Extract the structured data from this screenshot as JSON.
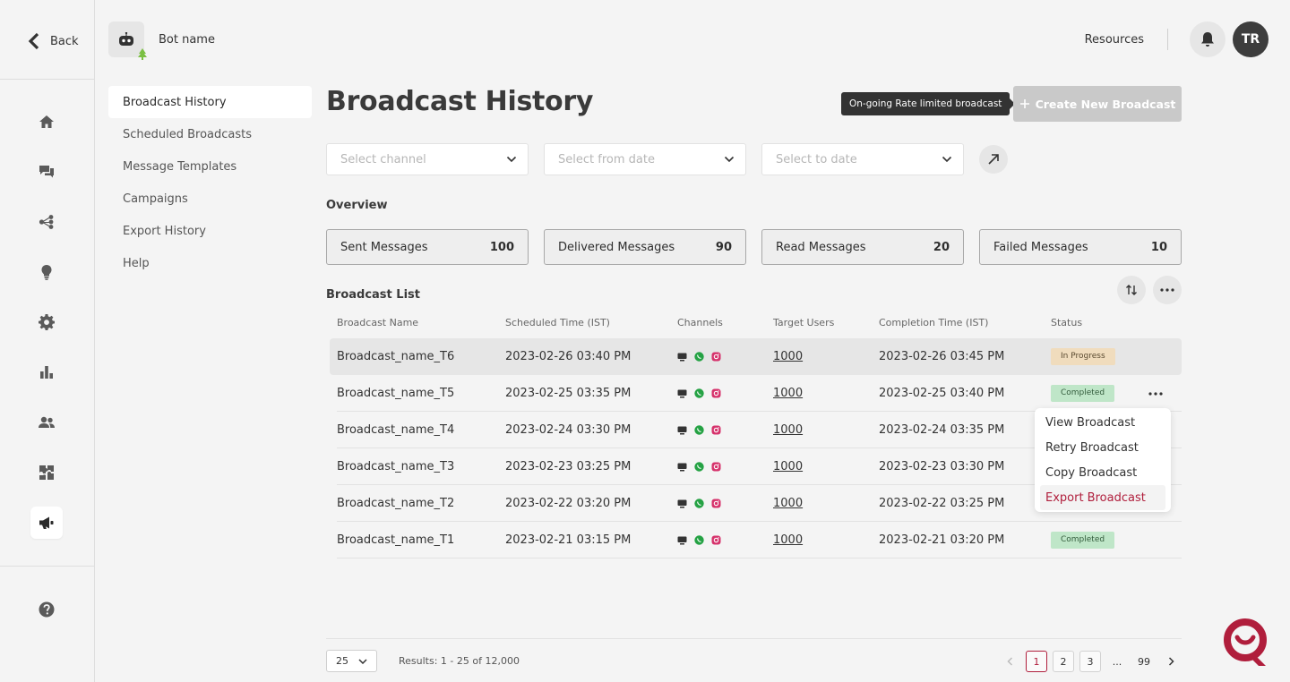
{
  "rail": {
    "back_label": "Back",
    "icons": [
      "home-icon",
      "chat-icon",
      "flow-icon",
      "bulb-icon",
      "settings-icon",
      "analytics-icon",
      "users-icon",
      "integrations-icon",
      "broadcast-icon",
      "help-icon"
    ],
    "active_icon": "broadcast-icon"
  },
  "bot": {
    "name": "Bot name"
  },
  "header": {
    "resources_label": "Resources",
    "avatar_initials": "TR"
  },
  "subnav": {
    "items": [
      {
        "label": "Broadcast History",
        "active": true
      },
      {
        "label": "Scheduled Broadcasts",
        "active": false
      },
      {
        "label": "Message Templates",
        "active": false
      },
      {
        "label": "Campaigns",
        "active": false
      },
      {
        "label": "Export History",
        "active": false
      },
      {
        "label": "Help",
        "active": false
      }
    ]
  },
  "page": {
    "title": "Broadcast History",
    "tooltip": "On-going Rate limited broadcast",
    "create_label": "Create New Broadcast"
  },
  "filters": {
    "channel_placeholder": "Select channel",
    "from_placeholder": "Select from date",
    "to_placeholder": "Select to date"
  },
  "overview": {
    "title": "Overview",
    "stats": [
      {
        "label": "Sent Messages",
        "value": "100"
      },
      {
        "label": "Delivered Messages",
        "value": "90"
      },
      {
        "label": "Read Messages",
        "value": "20"
      },
      {
        "label": "Failed Messages",
        "value": "10"
      }
    ]
  },
  "list": {
    "title": "Broadcast List",
    "columns": [
      "Broadcast Name",
      "Scheduled Time (IST)",
      "Channels",
      "Target Users",
      "Completion Time (IST)",
      "Status"
    ],
    "rows": [
      {
        "name": "Broadcast_name_T6",
        "scheduled": "2023-02-26 03:40 PM",
        "users": "1000",
        "completed": "2023-02-26 03:45 PM",
        "status": "In Progress"
      },
      {
        "name": "Broadcast_name_T5",
        "scheduled": "2023-02-25 03:35 PM",
        "users": "1000",
        "completed": "2023-02-25 03:40 PM",
        "status": "Completed"
      },
      {
        "name": "Broadcast_name_T4",
        "scheduled": "2023-02-24 03:30 PM",
        "users": "1000",
        "completed": "2023-02-24 03:35 PM",
        "status": ""
      },
      {
        "name": "Broadcast_name_T3",
        "scheduled": "2023-02-23 03:25 PM",
        "users": "1000",
        "completed": "2023-02-23 03:30 PM",
        "status": ""
      },
      {
        "name": "Broadcast_name_T2",
        "scheduled": "2023-02-22 03:20 PM",
        "users": "1000",
        "completed": "2023-02-22 03:25 PM",
        "status": ""
      },
      {
        "name": "Broadcast_name_T1",
        "scheduled": "2023-02-21 03:15 PM",
        "users": "1000",
        "completed": "2023-02-21 03:20 PM",
        "status": "Completed"
      }
    ]
  },
  "row_menu": {
    "items": [
      "View Broadcast",
      "Retry Broadcast",
      "Copy Broadcast",
      "Export Broadcast"
    ],
    "active_index": 3
  },
  "pager": {
    "per_page": "25",
    "results": "Results: 1 - 25 of 12,000",
    "pages": [
      "1",
      "2",
      "3",
      "...",
      "99"
    ]
  },
  "colors": {
    "accent": "#b01e3c",
    "whatsapp": "#25a244",
    "instagram": "#d6336c"
  }
}
